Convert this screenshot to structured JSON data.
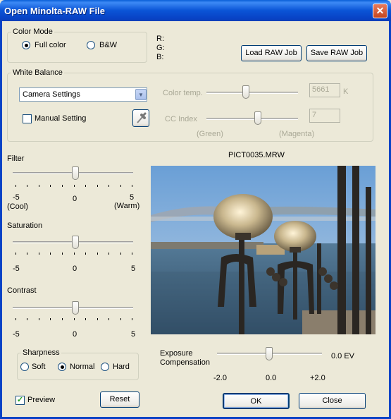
{
  "window": {
    "title": "Open Minolta-RAW File",
    "close_glyph": "✕"
  },
  "color_mode": {
    "legend": "Color Mode",
    "full_color": "Full color",
    "bw": "B&W",
    "selected": "Full color"
  },
  "rgb": {
    "r": "R:",
    "g": "G:",
    "b": "B:"
  },
  "jobs": {
    "load": "Load RAW Job",
    "save": "Save RAW Job"
  },
  "white_balance": {
    "legend": "White Balance",
    "mode": "Camera Settings",
    "manual_label": "Manual Setting",
    "manual_checked": false,
    "color_temp_label": "Color temp.",
    "color_temp_value": "5661",
    "color_temp_unit": "K",
    "cc_index_label": "CC Index",
    "cc_index_value": "7",
    "green_label": "(Green)",
    "magenta_label": "(Magenta)"
  },
  "filter": {
    "label": "Filter",
    "min": "-5",
    "mid": "0",
    "max": "5",
    "min_sub": "(Cool)",
    "max_sub": "(Warm)",
    "value": 0
  },
  "saturation": {
    "label": "Saturation",
    "min": "-5",
    "mid": "0",
    "max": "5",
    "value": 0
  },
  "contrast": {
    "label": "Contrast",
    "min": "-5",
    "mid": "0",
    "max": "5",
    "value": 0
  },
  "sharpness": {
    "legend": "Sharpness",
    "soft": "Soft",
    "normal": "Normal",
    "hard": "Hard",
    "selected": "Normal"
  },
  "preview": {
    "label": "Preview",
    "checked": true,
    "filename": "PICT0035.MRW"
  },
  "reset_label": "Reset",
  "exposure": {
    "label_line1": "Exposure",
    "label_line2": "Compensation",
    "value": "0.0 EV",
    "min": "-2.0",
    "mid": "0.0",
    "max": "+2.0"
  },
  "ok_label": "OK",
  "close_label": "Close",
  "icons": {
    "eyedropper": "eyedropper-icon",
    "dropdown": "chevron-down-icon"
  },
  "colors": {
    "titlebar": "#0a54d6",
    "dialog_bg": "#ece9d8",
    "close_button": "#c3451e",
    "sky": "#5b91c9",
    "water": "#3a5a74"
  }
}
